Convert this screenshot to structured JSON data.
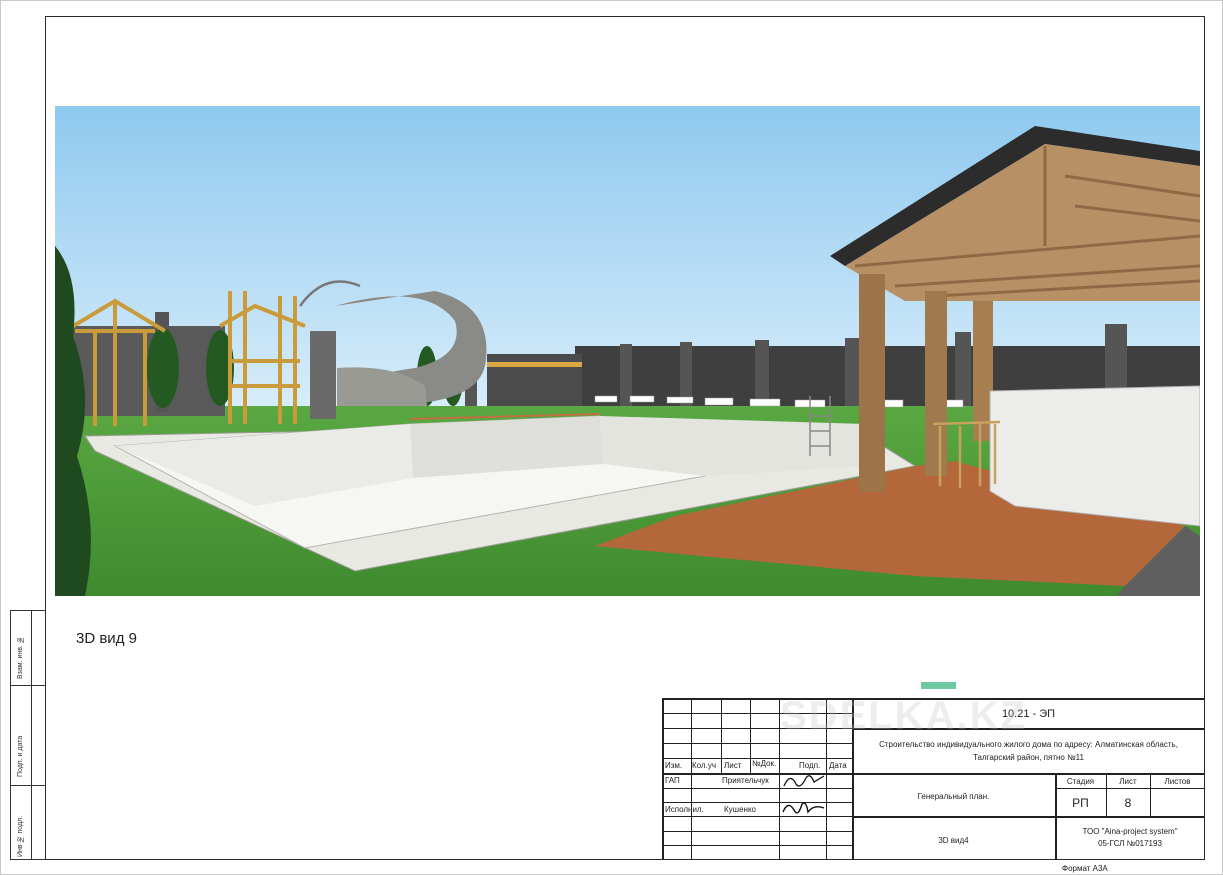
{
  "drawing": {
    "view_title": "3D вид 9",
    "format_label": "Формат А3А"
  },
  "side_stamp": {
    "labels": [
      "Взам. инв. №",
      "Подп. и дата",
      "Инв № подл."
    ]
  },
  "title_block": {
    "code": "10.21 - ЭП",
    "project_line1": "Строительство индивидуального жилого дома по адресу: Алматинская область,",
    "project_line2": "Талгарский район, пятно №11",
    "headers": [
      "Изм.",
      "Кол.уч",
      "Лист",
      "№Док.",
      "Подп.",
      "Дата"
    ],
    "roles": [
      {
        "role": "ГАП",
        "name": "Приятельчук"
      },
      {
        "role": "Исполнил.",
        "name": "Кушенко"
      }
    ],
    "sheet_name": "Генеральный план.",
    "sheet_subname": "3D вид4",
    "stage_label": "Стадия",
    "sheet_label": "Лист",
    "sheets_label": "Листов",
    "stage_value": "РП",
    "sheet_value": "8",
    "sheets_value": "",
    "company_line1": "ТОО \"Aina-project system\"",
    "company_line2": "05-ГСЛ №017193"
  },
  "watermark": "SDELKA.KZ",
  "colors": {
    "sky": "#a8d4f0",
    "grass": "#4e9a3a",
    "deck": "#b5673c",
    "pool": "#eeeeea",
    "wood": "#a8804f",
    "wall": "#4a4a4a",
    "accent": "#6ec9a3"
  }
}
